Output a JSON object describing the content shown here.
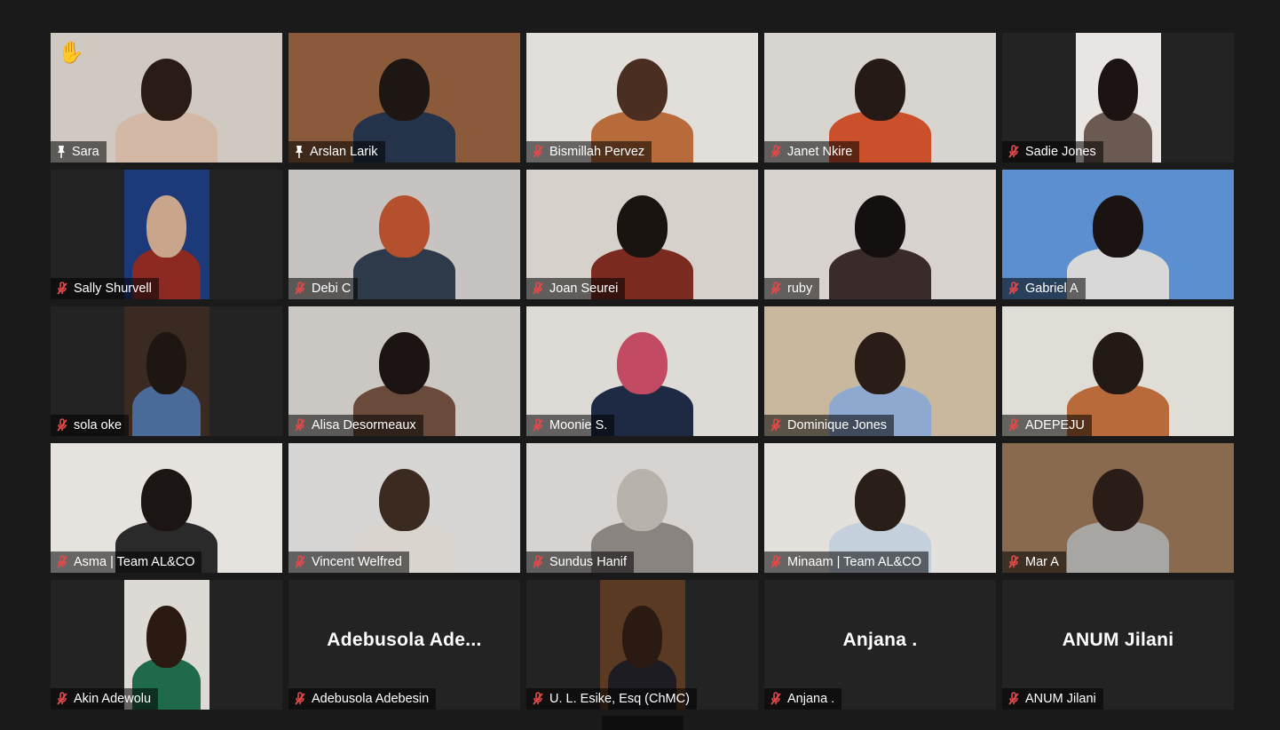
{
  "participants": [
    {
      "name": "Sara",
      "icon": "pin-icon",
      "raised_hand": true,
      "video": {
        "bg": "#cfc9c2",
        "head": "#2a1c14",
        "body": "#d4b8a6"
      }
    },
    {
      "name": "Arslan Larik",
      "icon": "pin-icon",
      "active_speaker": true,
      "video": {
        "bg": "#8b5a3a",
        "head": "#1d1612",
        "body": "#24334a"
      }
    },
    {
      "name": "Bismillah Pervez",
      "icon": "mic-muted-icon",
      "video": {
        "bg": "#e2dfdb",
        "head": "#4a2e22",
        "body": "#b76a3a"
      }
    },
    {
      "name": "Janet Nkire",
      "icon": "mic-muted-icon",
      "video": {
        "bg": "#d8d4d0",
        "head": "#251a15",
        "body": "#c9502a"
      }
    },
    {
      "name": "Sadie Jones",
      "icon": "mic-muted-icon",
      "narrow": true,
      "video": {
        "bg": "#e8e5e2",
        "head": "#1b1412",
        "body": "#6b5a52"
      }
    },
    {
      "name": "Sally Shurvell",
      "icon": "mic-muted-icon",
      "narrow": true,
      "video": {
        "bg": "#1c3a7a",
        "head": "#c9a58c",
        "body": "#8c2a22"
      }
    },
    {
      "name": "Debi C",
      "icon": "mic-muted-icon",
      "video": {
        "bg": "#c6c3c0",
        "head": "#b4502e",
        "body": "#2e3a4a"
      }
    },
    {
      "name": "Joan Seurei",
      "icon": "mic-muted-icon",
      "video": {
        "bg": "#d6d1cb",
        "head": "#1a1411",
        "body": "#7b2a20"
      }
    },
    {
      "name": "ruby",
      "icon": "mic-muted-icon",
      "video": {
        "bg": "#d9d3cf",
        "head": "#141010",
        "body": "#3a2a2a"
      }
    },
    {
      "name": "Gabriel A",
      "icon": "mic-muted-icon",
      "video": {
        "bg": "#5c8fcf",
        "head": "#1a1311",
        "body": "#d8d8d8"
      }
    },
    {
      "name": "sola oke",
      "icon": "mic-muted-icon",
      "narrow": true,
      "video": {
        "bg": "#3a2a22",
        "head": "#1e1612",
        "body": "#4a6a9a"
      }
    },
    {
      "name": "Alisa Desormeaux",
      "icon": "mic-muted-icon",
      "video": {
        "bg": "#cbc8c4",
        "head": "#1b1412",
        "body": "#6a4a3a"
      }
    },
    {
      "name": "Moonie S.",
      "icon": "mic-muted-icon",
      "video": {
        "bg": "#dedad6",
        "head": "#c24a62",
        "body": "#1e2a44"
      }
    },
    {
      "name": "Dominique Jones",
      "icon": "mic-muted-icon",
      "video": {
        "bg": "#c9b89e",
        "head": "#2a1c16",
        "body": "#8fa8cf"
      }
    },
    {
      "name": "ADEPEJU",
      "icon": "mic-muted-icon",
      "video": {
        "bg": "#e0dcd6",
        "head": "#231a15",
        "body": "#b86a3a"
      }
    },
    {
      "name": "Asma | Team AL&CO",
      "icon": "mic-muted-icon",
      "video": {
        "bg": "#e6e2de",
        "head": "#1b1513",
        "body": "#2a2a2a"
      }
    },
    {
      "name": "Vincent Welfred",
      "icon": "mic-muted-icon",
      "video": {
        "bg": "#d8d6d4",
        "head": "#3a2a20",
        "body": "#d9d4ce"
      }
    },
    {
      "name": "Sundus Hanif",
      "icon": "mic-muted-icon",
      "video": {
        "bg": "#d6d3d0",
        "head": "#b8b2ac",
        "body": "#8a8480"
      }
    },
    {
      "name": "Minaam | Team AL&CO",
      "icon": "mic-muted-icon",
      "video": {
        "bg": "#e4e0dc",
        "head": "#2a1e18",
        "body": "#c4d0dc"
      }
    },
    {
      "name": "Mar A",
      "icon": "mic-muted-icon",
      "video": {
        "bg": "#8a6a4e",
        "head": "#2a1c16",
        "body": "#a8a6a2"
      }
    },
    {
      "name": "Akin Adewolu",
      "icon": "mic-muted-icon",
      "narrow": true,
      "video": {
        "bg": "#ddd9d4",
        "head": "#2a1a12",
        "body": "#1e6a4a"
      }
    },
    {
      "name": "Adebusola Adebesin",
      "icon": "mic-muted-icon",
      "display_name": "Adebusola  Ade..."
    },
    {
      "name": "U. L. Esike, Esq (ChMC)",
      "icon": "mic-muted-icon",
      "narrow": true,
      "video": {
        "bg": "#5a3a22",
        "head": "#2a1a12",
        "body": "#1c1c22"
      }
    },
    {
      "name": "Anjana .",
      "icon": "mic-muted-icon",
      "display_name": "Anjana ."
    },
    {
      "name": "ANUM Jilani",
      "icon": "mic-muted-icon",
      "display_name": "ANUM Jilani"
    }
  ],
  "colors": {
    "active_speaker_border": "#d6e66b",
    "background": "#1a1a1a",
    "tile_background": "#232323",
    "muted_mic": "#e24a4a"
  }
}
